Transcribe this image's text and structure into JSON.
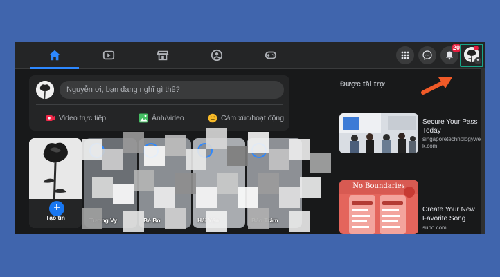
{
  "nav": {
    "tabs": [
      {
        "name": "home-icon",
        "active": true
      },
      {
        "name": "watch-icon",
        "active": false
      },
      {
        "name": "marketplace-icon",
        "active": false
      },
      {
        "name": "groups-icon",
        "active": false
      },
      {
        "name": "gaming-icon",
        "active": false
      }
    ],
    "right": {
      "menu_icon": "grid-menu-icon",
      "messenger_icon": "messenger-icon",
      "notifications_icon": "bell-icon",
      "notifications_badge": "20",
      "profile_icon": "profile-avatar"
    }
  },
  "composer": {
    "placeholder": "Nguyễn ơi, bạn đang nghĩ gì thế?",
    "actions": [
      {
        "label": "Video trực tiếp",
        "icon": "live-video-icon",
        "color": "#f02849"
      },
      {
        "label": "Ảnh/video",
        "icon": "photo-video-icon",
        "color": "#45bd62"
      },
      {
        "label": "Cảm xúc/hoạt động",
        "icon": "feeling-icon",
        "color": "#f7b928"
      }
    ]
  },
  "stories": [
    {
      "name": "Tạo tin"
    },
    {
      "name": "Tương Vy"
    },
    {
      "name": "Bé Bo"
    },
    {
      "name": "Hải Yến"
    },
    {
      "name": "Bảo Trâm"
    }
  ],
  "sponsored": {
    "title": "Được tài trợ",
    "ads": [
      {
        "title": "Secure Your Pass Today",
        "domain": "singaporetechnologyweek.com"
      },
      {
        "title": "Create Your New Favorite Song",
        "domain": "suno.com",
        "image_text": "No Boundaries"
      }
    ]
  },
  "colors": {
    "page_bg": "#4065ad",
    "app_bg": "#18191a",
    "surface": "#242526",
    "accent": "#2d88ff",
    "highlight_box": "#17a589",
    "arrow": "#f05a28"
  }
}
